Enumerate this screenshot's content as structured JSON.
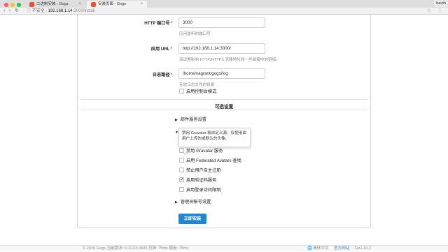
{
  "browser": {
    "tabs": [
      {
        "title": "二进制安装 - Gogs"
      },
      {
        "title": "安装页面 - Gogs"
      }
    ],
    "address": {
      "insecure_label": "不安全",
      "host": "192.168.1.14",
      "path": ":3000/install"
    },
    "user_badge": "bauth"
  },
  "form": {
    "http_port": {
      "label": "HTTP 端口号",
      "value": "3000",
      "help": "应用监听的端口号"
    },
    "app_url": {
      "label": "应用 URL",
      "value": "http://192.168.1.14:3000/",
      "help": "该设置影响 HTTP/HTTPS 克隆地址和一些邮箱中的链接。"
    },
    "log_path": {
      "label": "日志路径",
      "value": "/home/vagrant/gogs/log",
      "help": "存放日志文件的目录"
    },
    "console_mode": {
      "label": "启用控制台模式",
      "checked": false
    }
  },
  "optional": {
    "title": "可选设置",
    "email_section": "邮件服务设置",
    "tooltip": "禁用 Gravatar 和自定义源，仅使用由用户上传的或默认的头像。",
    "server_options": [
      {
        "label": "禁用 Gravatar 服务",
        "checked": false
      },
      {
        "label": "启用 Federated Avatars 查找",
        "checked": false
      },
      {
        "label": "禁止用户自主注册",
        "checked": false
      },
      {
        "label": "启用验证码服务",
        "checked": true
      },
      {
        "label": "启用登录访问限制",
        "checked": false
      }
    ],
    "admin_section": "管理员帐号设置"
  },
  "install_button": "立即安装",
  "footer": {
    "copyright": "© 2016 Gogs 当前版本: 0.11.53.0603 页面: 75ms 模板: 75ms",
    "language": "简体中文",
    "website": "官方网站",
    "go_version": "Go1.10.2"
  },
  "colors": {
    "primary": "#2185d0",
    "required": "#db2828"
  }
}
